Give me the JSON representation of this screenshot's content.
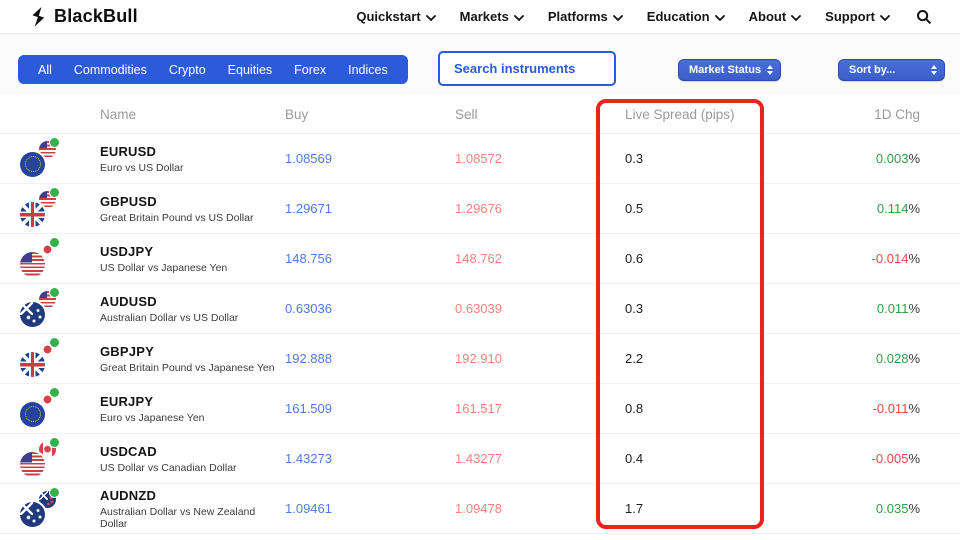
{
  "brand": {
    "name": "BlackBull"
  },
  "nav": {
    "items": [
      "Quickstart",
      "Markets",
      "Platforms",
      "Education",
      "About",
      "Support"
    ]
  },
  "filters": {
    "tabs": [
      "All",
      "Commodities",
      "Crypto",
      "Equities",
      "Forex",
      "Indices"
    ],
    "active": "All"
  },
  "search": {
    "placeholder": "Search instruments"
  },
  "dropdowns": {
    "market_status_label": "Market Status",
    "sort_by_label": "Sort by..."
  },
  "table": {
    "headers": {
      "name": "Name",
      "buy": "Buy",
      "sell": "Sell",
      "spread": "Live Spread (pips)",
      "change": "1D Chg"
    },
    "percent_sign": "%",
    "rows": [
      {
        "symbol": "EURUSD",
        "description": "Euro vs US Dollar",
        "buy": "1.08569",
        "sell": "1.08572",
        "spread": "0.3",
        "change": "0.003",
        "direction": "up",
        "base_flag": "eu",
        "quote_flag": "us",
        "status": "open"
      },
      {
        "symbol": "GBPUSD",
        "description": "Great Britain Pound vs US Dollar",
        "buy": "1.29671",
        "sell": "1.29676",
        "spread": "0.5",
        "change": "0.114",
        "direction": "up",
        "base_flag": "uk",
        "quote_flag": "us",
        "status": "open"
      },
      {
        "symbol": "USDJPY",
        "description": "US Dollar vs Japanese Yen",
        "buy": "148.756",
        "sell": "148.762",
        "spread": "0.6",
        "change": "-0.014",
        "direction": "down",
        "base_flag": "us",
        "quote_flag": "jp",
        "status": "open"
      },
      {
        "symbol": "AUDUSD",
        "description": "Australian Dollar vs US Dollar",
        "buy": "0.63036",
        "sell": "0.63039",
        "spread": "0.3",
        "change": "0.011",
        "direction": "up",
        "base_flag": "au",
        "quote_flag": "us",
        "status": "open"
      },
      {
        "symbol": "GBPJPY",
        "description": "Great Britain Pound vs Japanese Yen",
        "buy": "192.888",
        "sell": "192.910",
        "spread": "2.2",
        "change": "0.028",
        "direction": "up",
        "base_flag": "uk",
        "quote_flag": "jp",
        "status": "open"
      },
      {
        "symbol": "EURJPY",
        "description": "Euro vs Japanese Yen",
        "buy": "161.509",
        "sell": "161.517",
        "spread": "0.8",
        "change": "-0.011",
        "direction": "down",
        "base_flag": "eu",
        "quote_flag": "jp",
        "status": "open"
      },
      {
        "symbol": "USDCAD",
        "description": "US Dollar vs Canadian Dollar",
        "buy": "1.43273",
        "sell": "1.43277",
        "spread": "0.4",
        "change": "-0.005",
        "direction": "down",
        "base_flag": "us",
        "quote_flag": "ca",
        "status": "open"
      },
      {
        "symbol": "AUDNZD",
        "description": "Australian Dollar vs New Zealand Dollar",
        "buy": "1.09461",
        "sell": "1.09478",
        "spread": "1.7",
        "change": "0.035",
        "direction": "up",
        "base_flag": "au",
        "quote_flag": "nz",
        "status": "open"
      }
    ]
  },
  "annotation": {
    "purpose": "highlight of Live Spread (pips) column",
    "color": "#e8261e"
  },
  "colors": {
    "accent": "#2c5bd9",
    "buy": "#4f7ae6",
    "sell": "#f2837b",
    "positive": "#2f9e44",
    "negative": "#df4d48",
    "highlight": "#e8261e",
    "status_open": "#35b14b"
  }
}
